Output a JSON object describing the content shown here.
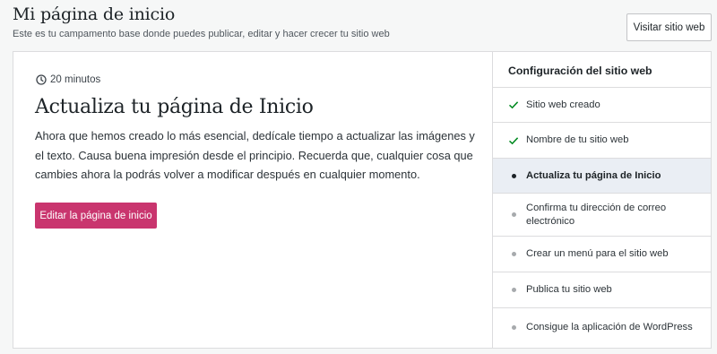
{
  "header": {
    "title": "Mi página de inicio",
    "subtitle": "Este es tu campamento base donde puedes publicar, editar y hacer crecer tu sitio web",
    "visit_button": "Visitar sitio web"
  },
  "task": {
    "duration": "20 minutos",
    "title": "Actualiza tu página de Inicio",
    "description": "Ahora que hemos creado lo más esencial, dedícale tiempo a actualizar las imágenes y el texto. Causa buena impresión desde el principio. Recuerda que, cualquier cosa que cambies ahora la podrás volver a modificar después en cualquier momento.",
    "button": "Editar la página de inicio"
  },
  "checklist": {
    "title": "Configuración del sitio web",
    "items": [
      {
        "label": "Sitio web creado",
        "status": "done"
      },
      {
        "label": "Nombre de tu sitio web",
        "status": "done"
      },
      {
        "label": "Actualiza tu página de Inicio",
        "status": "active"
      },
      {
        "label": "Confirma tu dirección de correo electrónico",
        "status": "pending"
      },
      {
        "label": "Crear un menú para el sitio web",
        "status": "pending"
      },
      {
        "label": "Publica tu sitio web",
        "status": "pending"
      },
      {
        "label": "Consigue la aplicación de WordPress",
        "status": "pending"
      }
    ]
  },
  "colors": {
    "accent": "#c9356e",
    "check": "#008a20",
    "active_bg": "#eaeef4"
  },
  "icons": [
    "clock-icon",
    "checkmark-icon",
    "bullet-icon"
  ]
}
